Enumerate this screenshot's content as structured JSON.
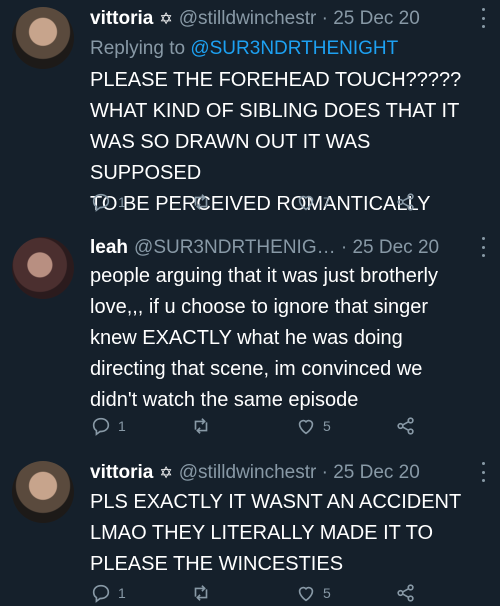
{
  "colors": {
    "background": "#15202b",
    "muted": "#8899a6",
    "link": "#1da1f2",
    "text": "#ffffff"
  },
  "tweets": [
    {
      "name": "vittoria",
      "badge": "✡",
      "meta": "@stilldwinchestr · 25 Dec 20",
      "replying_prefix": "Replying to ",
      "replying_handle": "@SUR3NDRTHENIGHT",
      "text_lines": [
        "PLEASE THE FOREHEAD TOUCH?????",
        "WHAT KIND OF SIBLING DOES THAT IT",
        "WAS SO DRAWN OUT IT WAS SUPPOSED",
        "TO BE PERCEIVED ROMANTICALLY"
      ],
      "reply_count": "1",
      "retweet_count": "",
      "like_count": "7"
    },
    {
      "name": "leah",
      "badge": "",
      "meta": "@SUR3NDRTHENIG… · 25 Dec 20",
      "text_lines": [
        "people arguing that it was just brotherly",
        "love,,, if u choose to ignore that singer",
        "knew EXACTLY what he was doing",
        "directing that scene, im convinced we",
        "didn't watch the same episode"
      ],
      "reply_count": "1",
      "retweet_count": "",
      "like_count": "5"
    },
    {
      "name": "vittoria",
      "badge": "✡",
      "meta": "@stilldwinchestr · 25 Dec 20",
      "text_lines": [
        "PLS EXACTLY IT WASNT AN ACCIDENT",
        "LMAO THEY LITERALLY MADE IT TO",
        "PLEASE THE WINCESTIES"
      ],
      "reply_count": "1",
      "retweet_count": "",
      "like_count": "5"
    }
  ],
  "icons": [
    "reply-icon",
    "retweet-icon",
    "like-icon",
    "share-icon",
    "more-icon"
  ]
}
